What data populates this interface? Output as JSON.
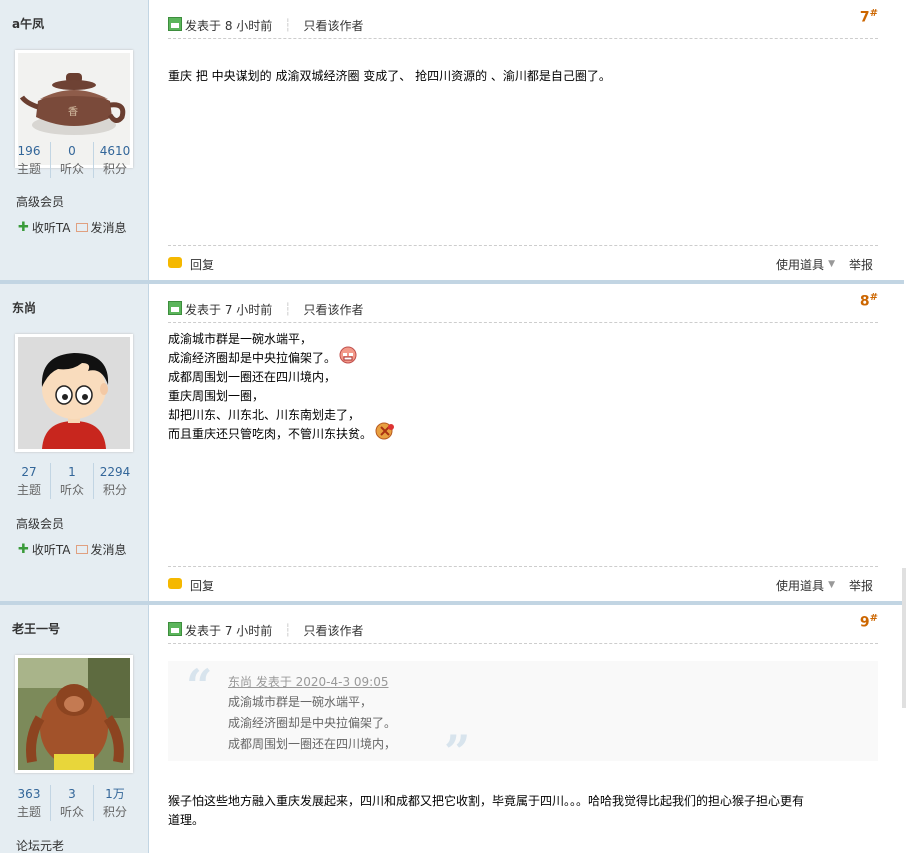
{
  "posts": [
    {
      "author": "a午凤",
      "stats": [
        {
          "num": "196",
          "label": "主题"
        },
        {
          "num": "0",
          "label": "听众"
        },
        {
          "num": "4610",
          "label": "积分"
        }
      ],
      "rank": "高级会员",
      "follow_label": "收听TA",
      "message_label": "发消息",
      "post_time": "发表于 8 小时前",
      "only_author": "只看该作者",
      "floor": "7",
      "lines": [
        "重庆 把 中央谋划的 成渝双城经济圈 变成了、 抢四川资源的  、渝川都是自己圈了。"
      ],
      "reply": "回复",
      "tools": "使用道具",
      "report": "举报",
      "avatar_icon": "teapot-avatar"
    },
    {
      "author": "东尚",
      "stats": [
        {
          "num": "27",
          "label": "主题"
        },
        {
          "num": "1",
          "label": "听众"
        },
        {
          "num": "2294",
          "label": "积分"
        }
      ],
      "rank": "高级会员",
      "follow_label": "收听TA",
      "message_label": "发消息",
      "post_time": "发表于 7 小时前",
      "only_author": "只看该作者",
      "floor": "8",
      "lines": [
        "成渝城市群是一碗水端平，",
        "成渝经济圈却是中央拉偏架了。",
        "成都周围划一圈还在四川境内，",
        "重庆周围划一圈，",
        "却把川东、川东北、川东南划走了，",
        "而且重庆还只管吃肉，不管川东扶贫。"
      ],
      "reply": "回复",
      "tools": "使用道具",
      "report": "举报",
      "avatar_icon": "cartoon-boy-avatar"
    },
    {
      "author": "老王一号",
      "stats": [
        {
          "num": "363",
          "label": "主题"
        },
        {
          "num": "3",
          "label": "听众"
        },
        {
          "num": "1万",
          "label": "积分"
        }
      ],
      "rank": "论坛元老",
      "post_time": "发表于 7 小时前",
      "only_author": "只看该作者",
      "floor": "9",
      "quote": {
        "head": "东尚 发表于 2020-4-3 09:05",
        "lines": [
          "成渝城市群是一碗水端平，",
          "成渝经济圈却是中央拉偏架了。",
          "成都周围划一圈还在四川境内，"
        ]
      },
      "lines": [
        "猴子怕这些地方融入重庆发展起来，四川和成都又把它收割，毕竟属于四川。。。哈哈我觉得比起我们的担心猴子担心更有",
        "道理。"
      ],
      "avatar_icon": "orangutan-avatar"
    }
  ],
  "colors": {
    "sidebar_bg": "#e5edf2",
    "separator": "#c2d5e3",
    "floor_number": "#cc6600",
    "stat_number": "#336699"
  }
}
